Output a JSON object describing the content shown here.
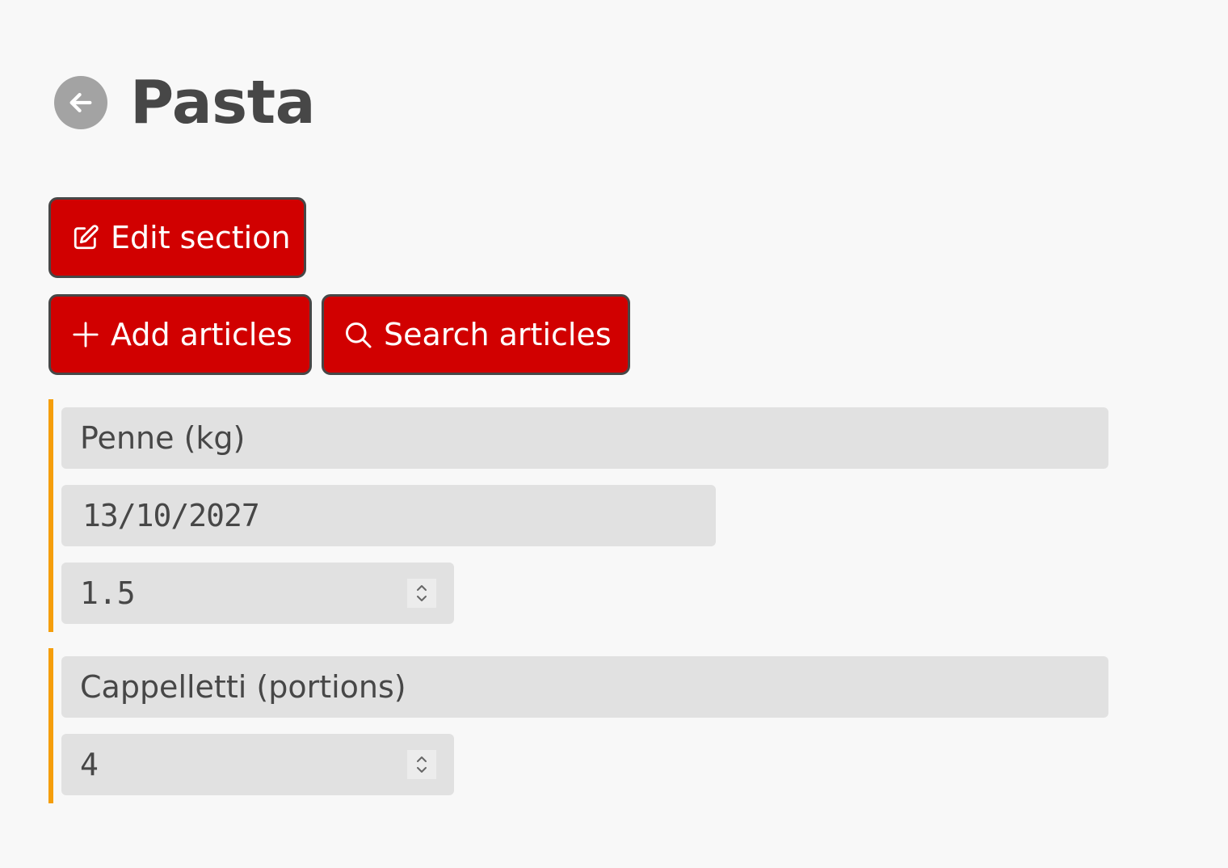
{
  "header": {
    "title": "Pasta",
    "back_icon": "arrow-left-icon"
  },
  "toolbar": {
    "edit_label": "Edit section",
    "edit_icon": "edit-icon",
    "add_label": "Add articles",
    "add_icon": "plus-icon",
    "search_label": "Search articles",
    "search_icon": "search-icon"
  },
  "colors": {
    "accent": "#d10000",
    "group_border": "#f59e0b",
    "field_bg": "#e1e1e1",
    "text": "#474747",
    "background": "#f8f8f8"
  },
  "articles": [
    {
      "name": "Penne (kg)",
      "date": "13/10/2027",
      "quantity": "1.5"
    },
    {
      "name": "Cappelletti (portions)",
      "quantity": "4"
    }
  ]
}
